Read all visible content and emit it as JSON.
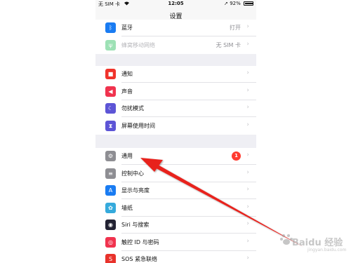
{
  "status": {
    "carrier": "无 SIM 卡",
    "time": "12:05",
    "battery": "92%",
    "battery_level": 0.92
  },
  "nav": {
    "title": "设置"
  },
  "group1": [
    {
      "label": "蓝牙",
      "value": "打开",
      "icon": "bluetooth-icon",
      "color": "#1a7cf2"
    },
    {
      "label": "蜂窝移动网络",
      "value": "无 SIM 卡",
      "icon": "antenna-icon",
      "color": "#3ec46d",
      "dimmed": true
    }
  ],
  "group2": [
    {
      "label": "通知",
      "icon": "notification-icon",
      "color": "#f0332b"
    },
    {
      "label": "声音",
      "icon": "speaker-icon",
      "color": "#f0334e"
    },
    {
      "label": "勿扰模式",
      "icon": "moon-icon",
      "color": "#5d55d6"
    },
    {
      "label": "屏幕使用时间",
      "icon": "hourglass-icon",
      "color": "#5d55d6"
    }
  ],
  "group3": [
    {
      "label": "通用",
      "icon": "gear-icon",
      "color": "#8e8e93",
      "badge": "1"
    },
    {
      "label": "控制中心",
      "icon": "toggles-icon",
      "color": "#8e8e93"
    },
    {
      "label": "显示与亮度",
      "icon": "text-size-icon",
      "color": "#1a7cf2"
    },
    {
      "label": "墙纸",
      "icon": "flower-icon",
      "color": "#35aadc"
    },
    {
      "label": "Siri 与搜索",
      "icon": "siri-icon",
      "color": "#222233"
    },
    {
      "label": "触控 ID 与密码",
      "icon": "fingerprint-icon",
      "color": "#f0334e"
    },
    {
      "label": "SOS 紧急联络",
      "icon": "sos-icon",
      "color": "#e8322b"
    }
  ],
  "watermark": {
    "text": "Baidu 经验",
    "url": "jingyan.baidu.com"
  },
  "colors": {
    "arrow": "#e8201c",
    "background": "#efeff4"
  }
}
